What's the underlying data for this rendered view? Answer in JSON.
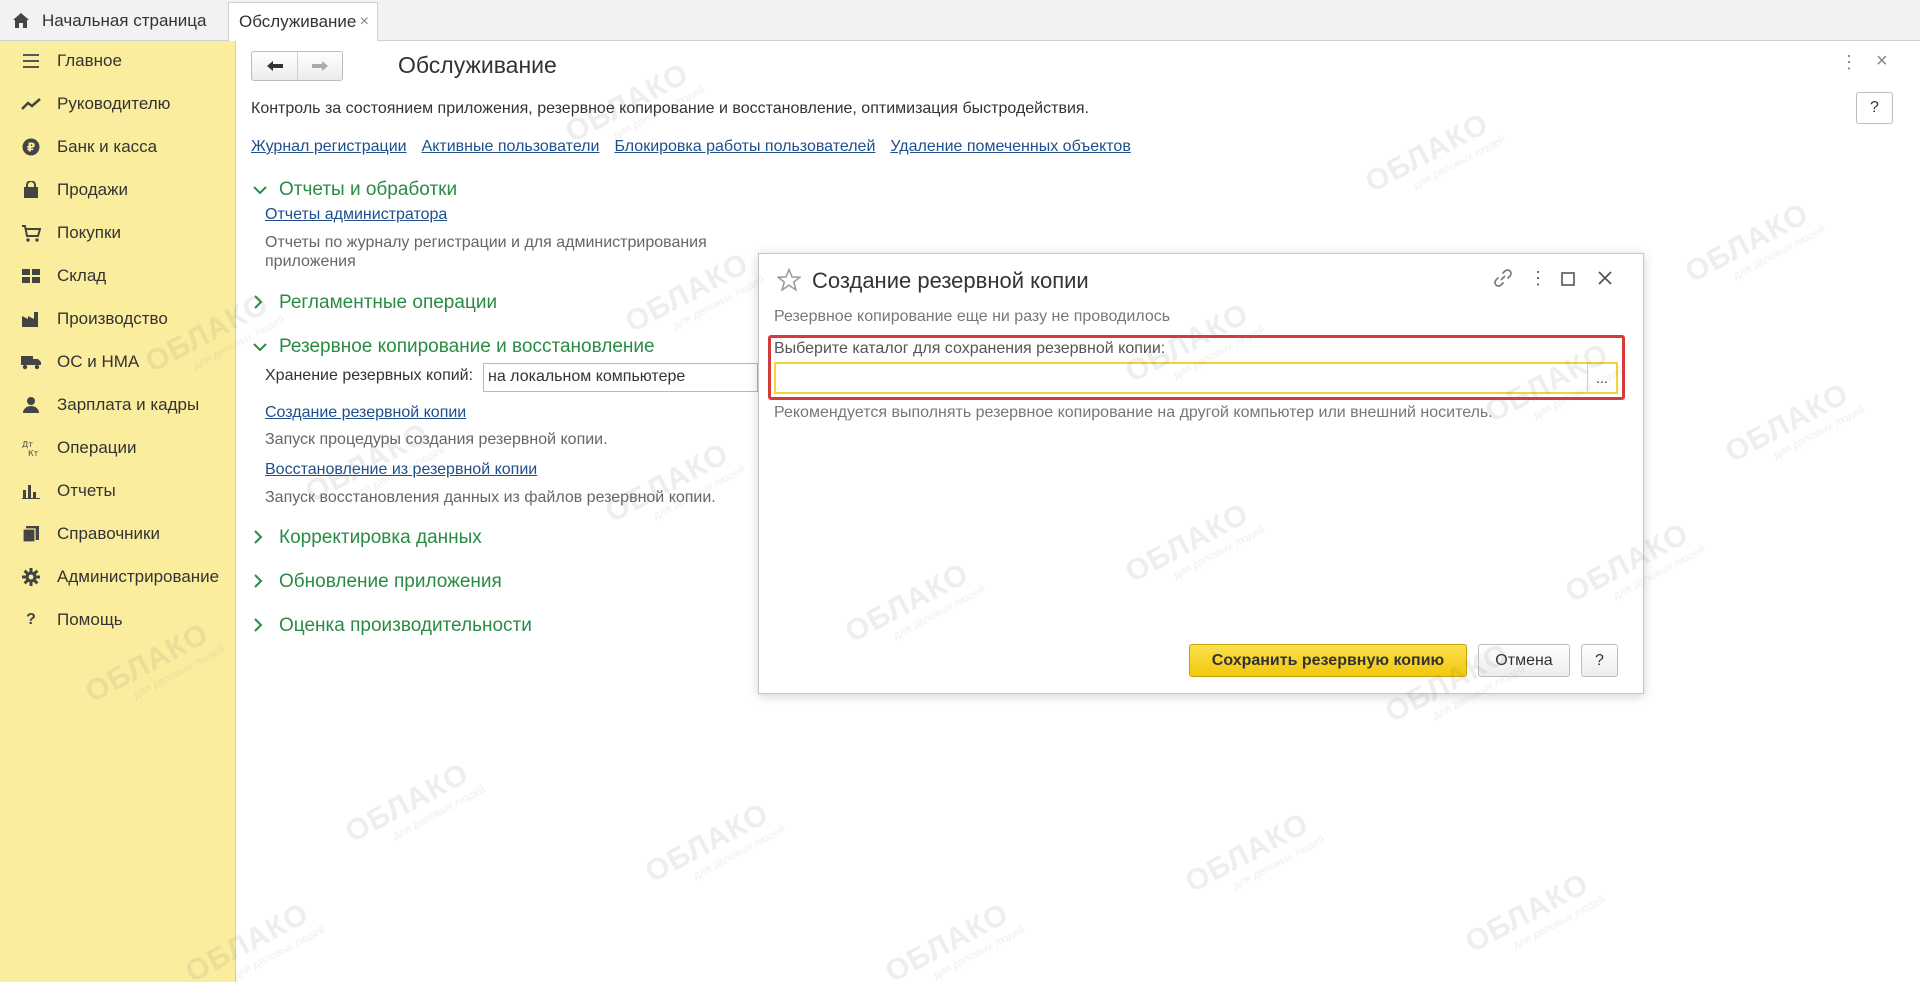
{
  "tabs": {
    "home_label": "Начальная страница",
    "active_label": "Обслуживание",
    "close_symbol": "×"
  },
  "sidebar": {
    "items": [
      {
        "label": "Главное",
        "icon": "menu-icon"
      },
      {
        "label": "Руководителю",
        "icon": "trend-icon"
      },
      {
        "label": "Банк и касса",
        "icon": "ruble-icon"
      },
      {
        "label": "Продажи",
        "icon": "bag-icon"
      },
      {
        "label": "Покупки",
        "icon": "cart-icon"
      },
      {
        "label": "Склад",
        "icon": "warehouse-icon"
      },
      {
        "label": "Производство",
        "icon": "factory-icon"
      },
      {
        "label": "ОС и НМА",
        "icon": "truck-icon"
      },
      {
        "label": "Зарплата и кадры",
        "icon": "person-icon"
      },
      {
        "label": "Операции",
        "icon": "dt-kt-icon"
      },
      {
        "label": "Отчеты",
        "icon": "bar-chart-icon"
      },
      {
        "label": "Справочники",
        "icon": "books-icon"
      },
      {
        "label": "Администрирование",
        "icon": "gear-icon"
      },
      {
        "label": "Помощь",
        "icon": "question-icon"
      }
    ]
  },
  "main": {
    "title": "Обслуживание",
    "description": "Контроль за состоянием приложения, резервное копирование и восстановление, оптимизация быстродействия.",
    "help_label": "?",
    "links": [
      "Журнал регистрации",
      "Активные пользователи",
      "Блокировка работы пользователей",
      "Удаление помеченных объектов"
    ],
    "sections": {
      "reports": "Отчеты и обработки",
      "reports_link": "Отчеты администратора",
      "reports_desc": "Отчеты по журналу регистрации и для администрирования приложения",
      "scheduled": "Регламентные операции",
      "backup": "Резервное копирование и восстановление",
      "storage_label": "Хранение резервных копий:",
      "storage_value": "на локальном компьютере",
      "create_link": "Создание резервной копии",
      "create_desc": "Запуск процедуры создания резервной копии.",
      "restore_link": "Восстановление из резервной копии",
      "restore_desc": "Запуск восстановления данных из файлов резервной копии.",
      "correction": "Корректировка данных",
      "update": "Обновление приложения",
      "performance": "Оценка производительности"
    }
  },
  "dialog": {
    "title": "Создание резервной копии",
    "status": "Резервное копирование еще ни разу не проводилось",
    "field_label": "Выберите каталог для сохранения резервной копии:",
    "field_value": "",
    "ellipsis": "...",
    "hint": "Рекомендуется выполнять резервное копирование на другой компьютер или внешний носитель.",
    "save_label": "Сохранить резервную копию",
    "cancel_label": "Отмена",
    "help_label": "?"
  },
  "watermark": {
    "text": "ОБЛАКО",
    "subtext": "для деловых людей"
  },
  "colors": {
    "sidebar_bg": "#fbed9e",
    "section_green": "#2a8b44",
    "link_blue": "#1e4f8c",
    "highlight_red": "#d63b3b",
    "primary_yellow": "#f2c80e"
  }
}
